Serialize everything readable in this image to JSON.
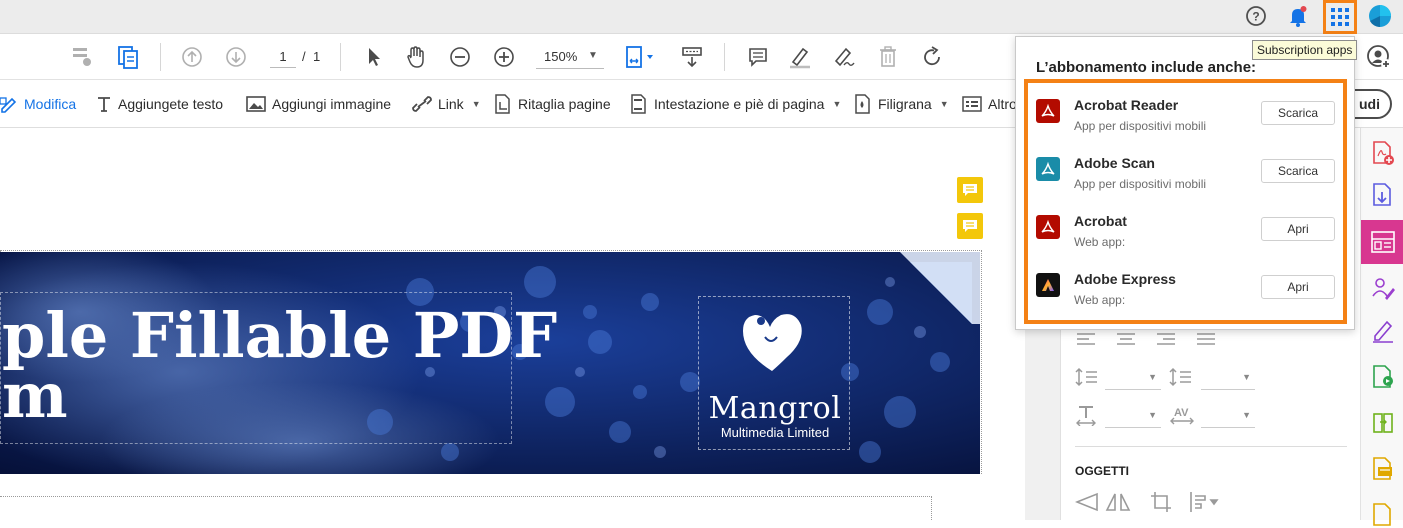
{
  "colors": {
    "accent": "#f48115",
    "blue": "#1473e6",
    "banner": "#0b1f5c",
    "note": "#f3c70a"
  },
  "topbar": {
    "help_icon": "help-icon",
    "bell_icon": "bell-icon",
    "apps_icon": "apps-grid-icon",
    "avatar_icon": "avatar-icon"
  },
  "toolbar": {
    "page_current": "1",
    "page_sep": "/",
    "page_total": "1",
    "zoom": "150%"
  },
  "editbar": {
    "items": [
      {
        "label": "Modifica",
        "icon": "edit-icon"
      },
      {
        "label": "Aggiungete testo",
        "icon": "text-icon"
      },
      {
        "label": "Aggiungi immagine",
        "icon": "image-icon"
      },
      {
        "label": "Link",
        "icon": "link-icon"
      },
      {
        "label": "Ritaglia pagine",
        "icon": "crop-page-icon"
      },
      {
        "label": "Intestazione e piè di pagina",
        "icon": "header-footer-icon"
      },
      {
        "label": "Filigrana",
        "icon": "watermark-icon"
      },
      {
        "label": "Altro",
        "icon": "more-icon"
      }
    ],
    "close_label": "udi"
  },
  "tooltip": "Subscription apps",
  "popup": {
    "title": "L’abbonamento include anche:",
    "apps": [
      {
        "name": "Acrobat Reader",
        "sub": "App per dispositivi mobili",
        "button": "Scarica",
        "logo_color": "#b30b00"
      },
      {
        "name": "Adobe Scan",
        "sub": "App per dispositivi mobili",
        "button": "Scarica",
        "logo_color": "#1a8ca8"
      },
      {
        "name": "Acrobat",
        "sub": "Web app:",
        "button": "Apri",
        "logo_color": "#b30b00"
      },
      {
        "name": "Adobe Express",
        "sub": "Web app:",
        "button": "Apri",
        "logo_color": "#111111"
      }
    ]
  },
  "document": {
    "title_line1": "ple Fillable PDF",
    "title_line2": "m",
    "brand_name": "Mangrol",
    "brand_sub": "Multimedia Limited"
  },
  "rightpanel": {
    "section_label": "OGGETTI"
  }
}
